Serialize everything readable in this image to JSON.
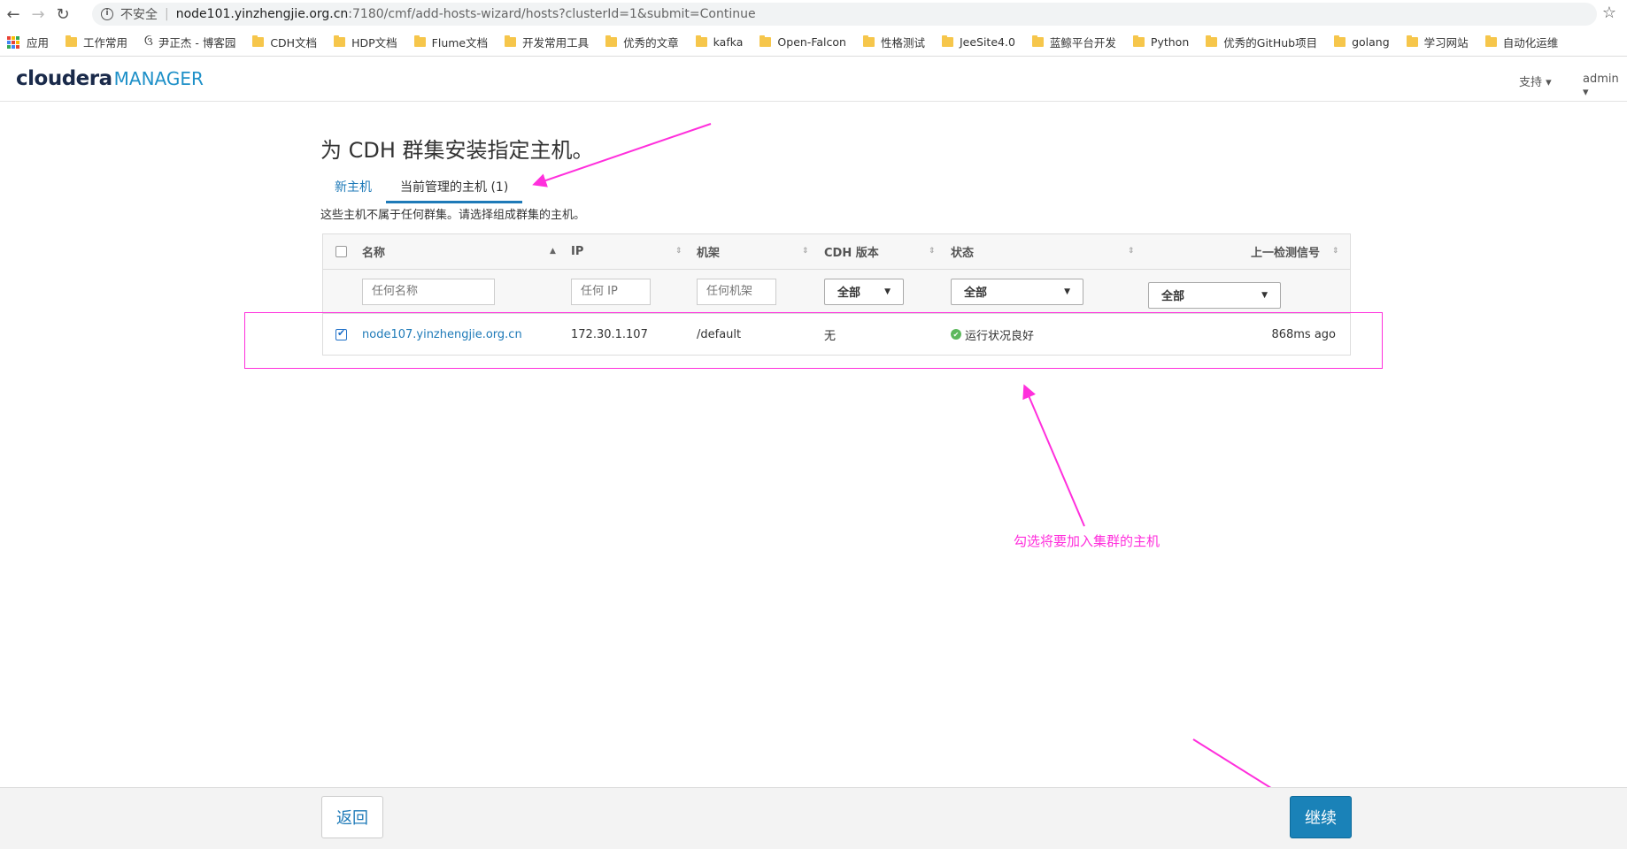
{
  "browser": {
    "insecure_label": "不安全",
    "url_host": "node101.yinzhengjie.org.cn",
    "url_path": ":7180/cmf/add-hosts-wizard/hosts?clusterId=1&submit=Continue",
    "bookmarks": [
      "应用",
      "工作常用",
      "尹正杰 - 博客园",
      "CDH文档",
      "HDP文档",
      "Flume文档",
      "开发常用工具",
      "优秀的文章",
      "kafka",
      "Open-Falcon",
      "性格测试",
      "JeeSite4.0",
      "蓝鲸平台开发",
      "Python",
      "优秀的GitHub项目",
      "golang",
      "学习网站",
      "自动化运维"
    ]
  },
  "header": {
    "logo_brand": "cloudera",
    "logo_product": "MANAGER",
    "support": "支持 ▾",
    "user": "admin ▾"
  },
  "main": {
    "title": "为 CDH 群集安装指定主机。",
    "tabs": [
      {
        "label": "新主机",
        "active": false
      },
      {
        "label": "当前管理的主机 (1)",
        "active": true
      }
    ],
    "description": "这些主机不属于任何群集。请选择组成群集的主机。",
    "table": {
      "columns": [
        "名称",
        "IP",
        "机架",
        "CDH 版本",
        "状态",
        "上一检测信号"
      ],
      "filters": {
        "name_placeholder": "任何名称",
        "ip_placeholder": "任何 IP",
        "rack_placeholder": "任何机架",
        "cdh_version": "全部",
        "status": "全部",
        "heartbeat": "全部"
      },
      "rows": [
        {
          "checked": true,
          "name": "node107.yinzhengjie.org.cn",
          "ip": "172.30.1.107",
          "rack": "/default",
          "cdh_version": "无",
          "status": "运行状况良好",
          "heartbeat": "868ms ago"
        }
      ]
    },
    "annotation": "勾选将要加入集群的主机"
  },
  "footer": {
    "back": "返回",
    "continue": "继续"
  },
  "colors": {
    "accent": "#1e7ab8",
    "primary_button": "#1a82b8",
    "annotation": "#ff2fdc",
    "ok": "#5cb85c"
  }
}
